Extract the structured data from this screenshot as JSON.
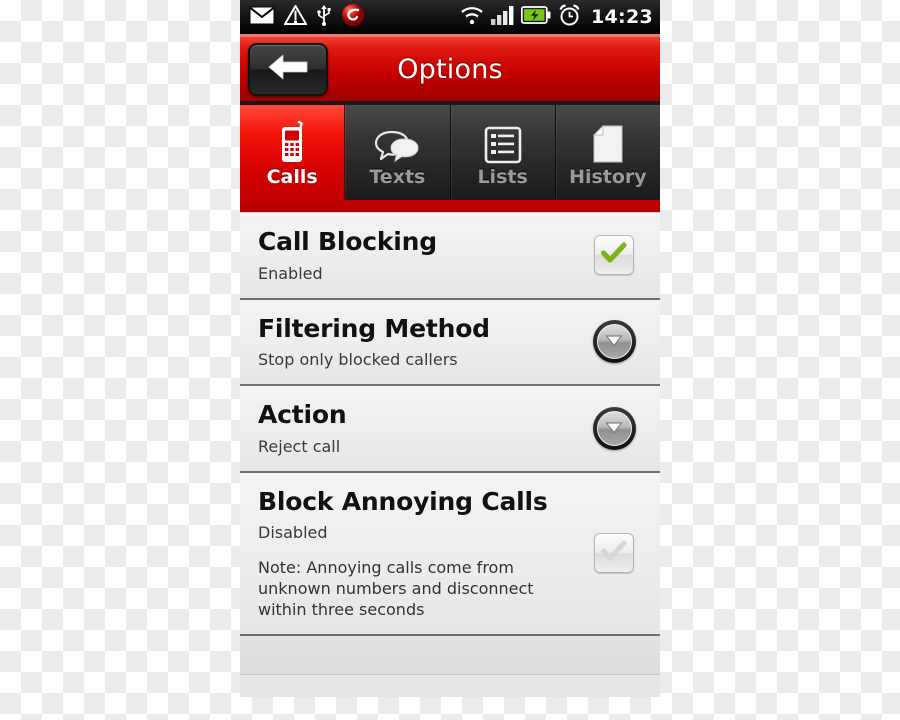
{
  "statusbar": {
    "icons_left": [
      "mail-icon",
      "upload-triangle-icon",
      "usb-icon",
      "app-badge-icon"
    ],
    "icons_right": [
      "wifi-icon",
      "signal-bars-icon",
      "battery-charging-icon",
      "alarm-clock-icon"
    ],
    "time": "14:23"
  },
  "header": {
    "title": "Options",
    "back_icon": "back-arrow-icon",
    "accent_color": "#c60000"
  },
  "tabs": [
    {
      "label": "Calls",
      "icon": "cellphone-icon",
      "active": true
    },
    {
      "label": "Texts",
      "icon": "speech-bubbles-icon",
      "active": false
    },
    {
      "label": "Lists",
      "icon": "bullet-list-icon",
      "active": false
    },
    {
      "label": "History",
      "icon": "document-page-icon",
      "active": false
    }
  ],
  "settings": [
    {
      "title": "Call Blocking",
      "value": "Enabled",
      "control": "checkbox",
      "checked": true,
      "enabled": true,
      "check_color": "#7cb518"
    },
    {
      "title": "Filtering Method",
      "value": "Stop only blocked callers",
      "control": "dropdown",
      "icon": "chevron-down-icon"
    },
    {
      "title": "Action",
      "value": "Reject call",
      "control": "dropdown",
      "icon": "chevron-down-icon"
    },
    {
      "title": "Block Annoying Calls",
      "value": "Disabled",
      "note": "Note: Annoying calls come from unknown numbers and disconnect within three seconds",
      "control": "checkbox",
      "checked": false,
      "enabled": false,
      "check_color": "#d2d2d2"
    }
  ]
}
